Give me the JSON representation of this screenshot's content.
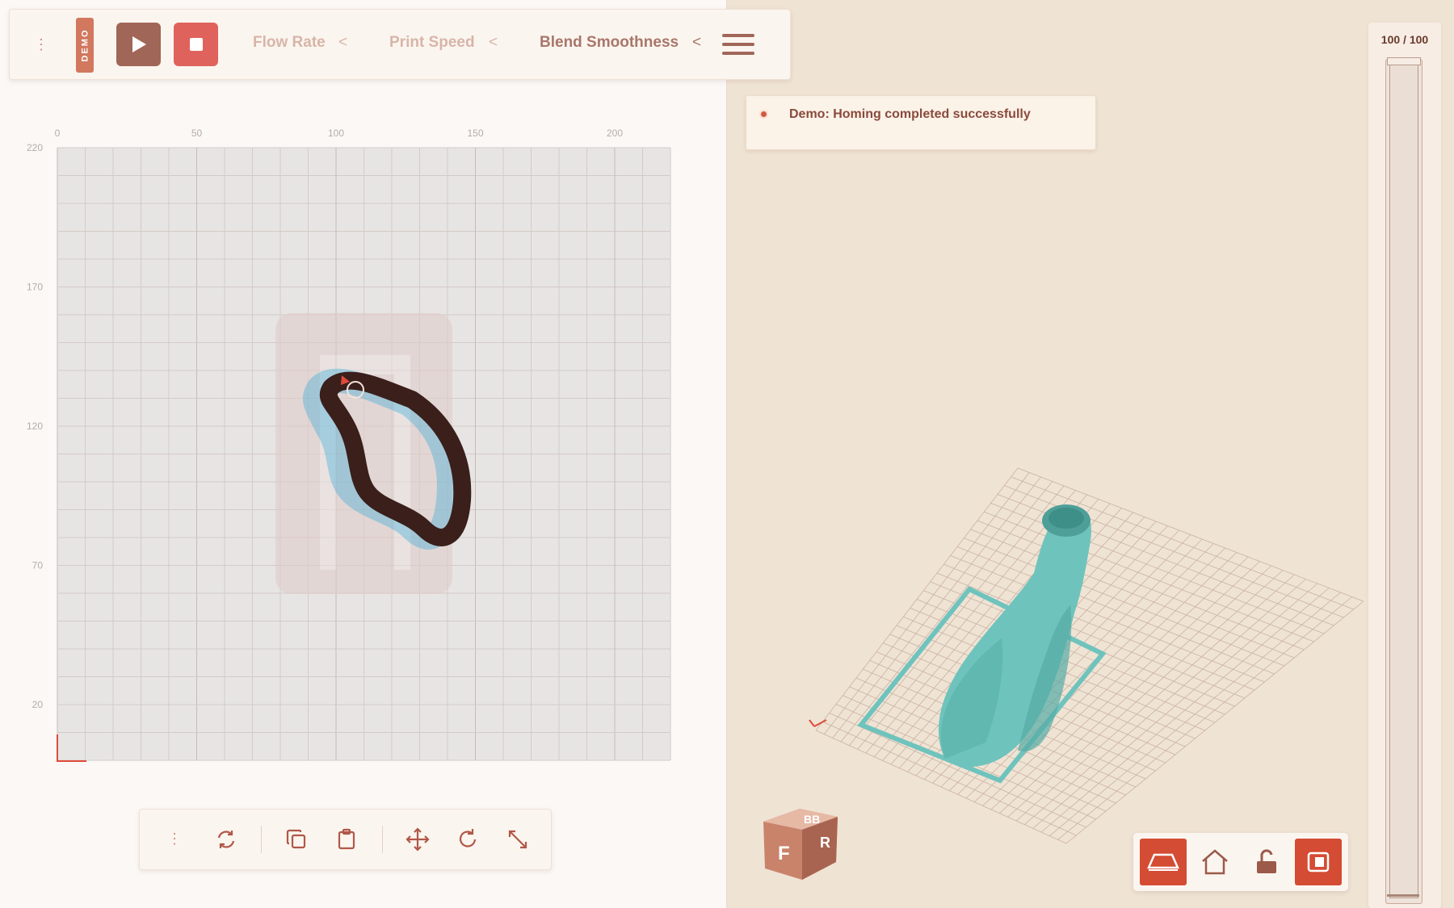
{
  "toolbar": {
    "demo_label": "DEMO",
    "params": [
      {
        "label": "Flow Rate",
        "chevron": "<",
        "active": false
      },
      {
        "label": "Print Speed",
        "chevron": "<",
        "active": false
      },
      {
        "label": "Blend Smoothness",
        "chevron": "<",
        "active": true
      }
    ],
    "icons": {
      "grip": "drag-handle-icon",
      "play": "play-icon",
      "stop": "stop-icon",
      "menu": "hamburger-menu-icon"
    }
  },
  "plot": {
    "x_ticks": [
      "0",
      "50",
      "100",
      "150",
      "200"
    ],
    "y_ticks": [
      "220",
      "170",
      "120",
      "70",
      "20"
    ],
    "x_range": [
      0,
      220
    ],
    "y_range": [
      0,
      220
    ],
    "grid": true
  },
  "bottom_toolbar": {
    "icons": [
      "drag-handle-icon",
      "refresh-icon",
      "copy-icon",
      "paste-icon",
      "move-icon",
      "rotate-icon",
      "scale-icon"
    ]
  },
  "notification": {
    "text": "Demo: Homing completed successfully",
    "status_color": "#d25a43"
  },
  "layer_slider": {
    "current": 100,
    "total": 100,
    "label": "100 / 100"
  },
  "view_controls": {
    "icons": [
      "bed-view-icon",
      "home-icon",
      "unlock-icon",
      "layers-panel-icon"
    ]
  },
  "view_cube": {
    "faces": [
      "F",
      "R",
      "BB"
    ]
  },
  "colors": {
    "accent": "#d44c33",
    "path": "#3a1f1b",
    "model": "#6fc3bd",
    "path_glow": "#2aa7d6"
  }
}
